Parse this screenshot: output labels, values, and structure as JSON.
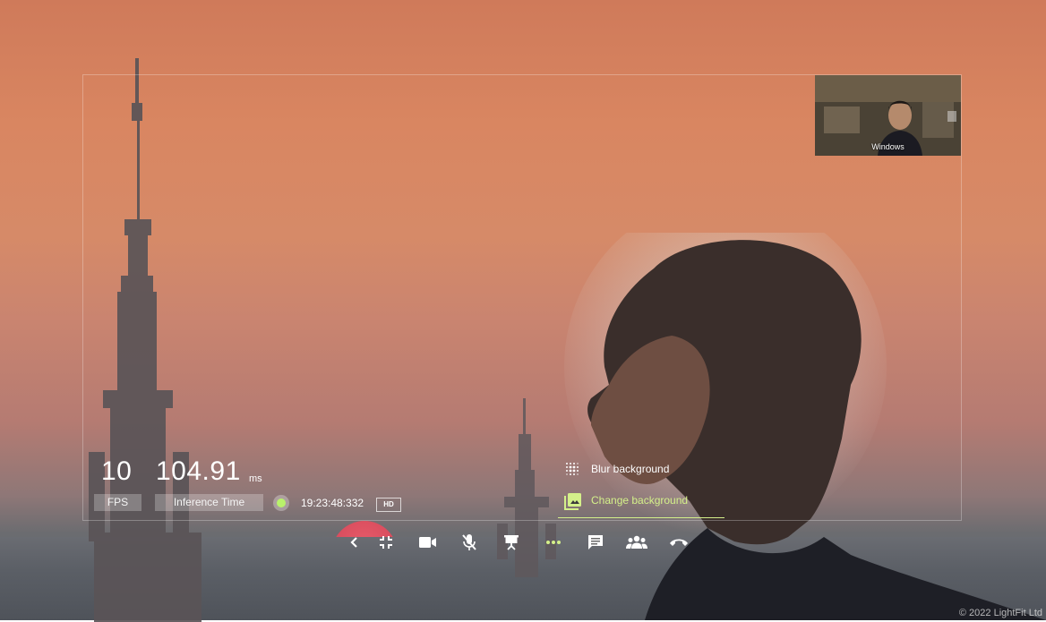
{
  "stats": {
    "fps_value": "10",
    "fps_label": "FPS",
    "inference_value": "104.91",
    "inference_unit": "ms",
    "inference_label": "Inference Time"
  },
  "status": {
    "clock": "19:23:48:332",
    "quality_badge": "HD",
    "indicator_color": "#b9f26b"
  },
  "pip": {
    "label": "Windows"
  },
  "background_menu": {
    "items": [
      {
        "label": "Blur background",
        "icon": "blur-icon",
        "active": false
      },
      {
        "label": "Change background",
        "icon": "image-icon",
        "active": true
      }
    ],
    "active_color": "#d4f08a"
  },
  "toolbar": {
    "buttons": [
      {
        "name": "chevron-left-icon"
      },
      {
        "name": "exit-fullscreen-icon"
      },
      {
        "name": "camera-icon"
      },
      {
        "name": "mic-off-icon"
      },
      {
        "name": "present-icon"
      },
      {
        "name": "more-icon"
      },
      {
        "name": "chat-icon"
      },
      {
        "name": "participants-icon"
      },
      {
        "name": "hang-up-icon"
      }
    ]
  },
  "watermark": "© 2022 LightFit Ltd"
}
